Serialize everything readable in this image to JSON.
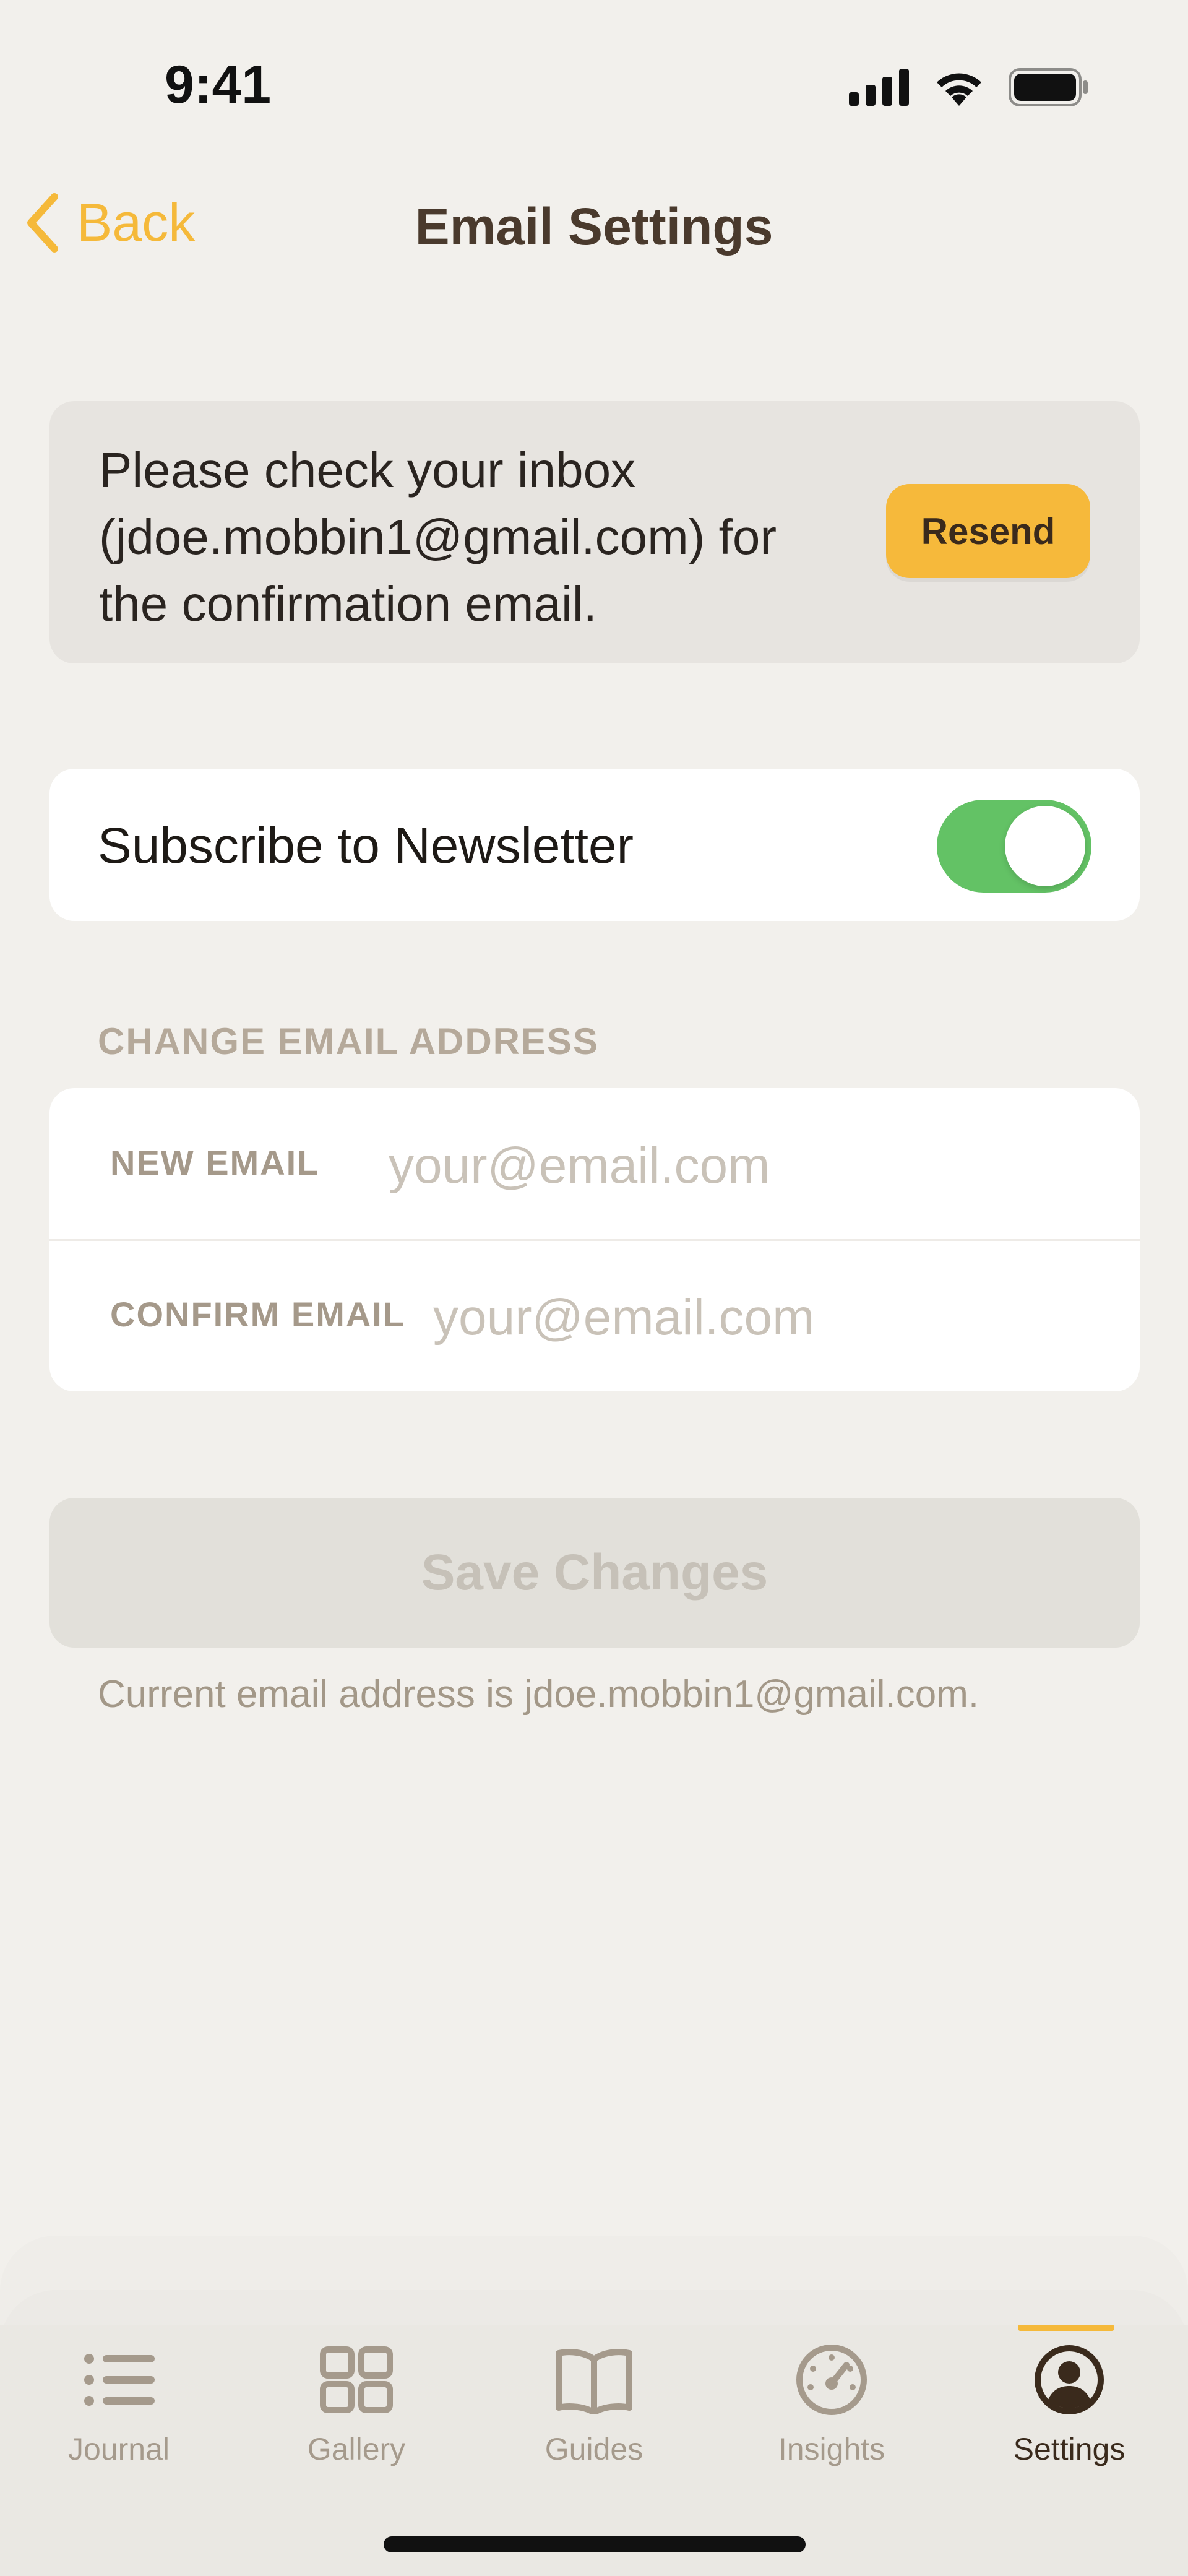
{
  "status_bar": {
    "time": "9:41",
    "icons": [
      "signal-icon",
      "wifi-icon",
      "battery-icon"
    ]
  },
  "nav": {
    "back_label": "Back",
    "title": "Email Settings"
  },
  "confirmation": {
    "message": "Please check your inbox (jdoe.mobbin1@gmail.com) for the confirmation email.",
    "resend_label": "Resend"
  },
  "newsletter": {
    "label": "Subscribe to Newsletter",
    "enabled": true
  },
  "change_email": {
    "section_header": "CHANGE EMAIL ADDRESS",
    "new_email_label": "NEW EMAIL",
    "new_email_placeholder": "your@email.com",
    "new_email_value": "",
    "confirm_email_label": "CONFIRM EMAIL",
    "confirm_email_placeholder": "your@email.com",
    "confirm_email_value": ""
  },
  "save": {
    "label": "Save Changes",
    "current_email_note": "Current email address is jdoe.mobbin1@gmail.com."
  },
  "tabs": [
    {
      "label": "Journal",
      "icon": "list-icon",
      "active": false
    },
    {
      "label": "Gallery",
      "icon": "grid-icon",
      "active": false
    },
    {
      "label": "Guides",
      "icon": "book-icon",
      "active": false
    },
    {
      "label": "Insights",
      "icon": "gauge-icon",
      "active": false
    },
    {
      "label": "Settings",
      "icon": "profile-icon",
      "active": true
    }
  ],
  "colors": {
    "accent": "#F5B93A",
    "toggle_on": "#63C265",
    "background": "#F2F0EC",
    "title": "#4A3A2D"
  }
}
